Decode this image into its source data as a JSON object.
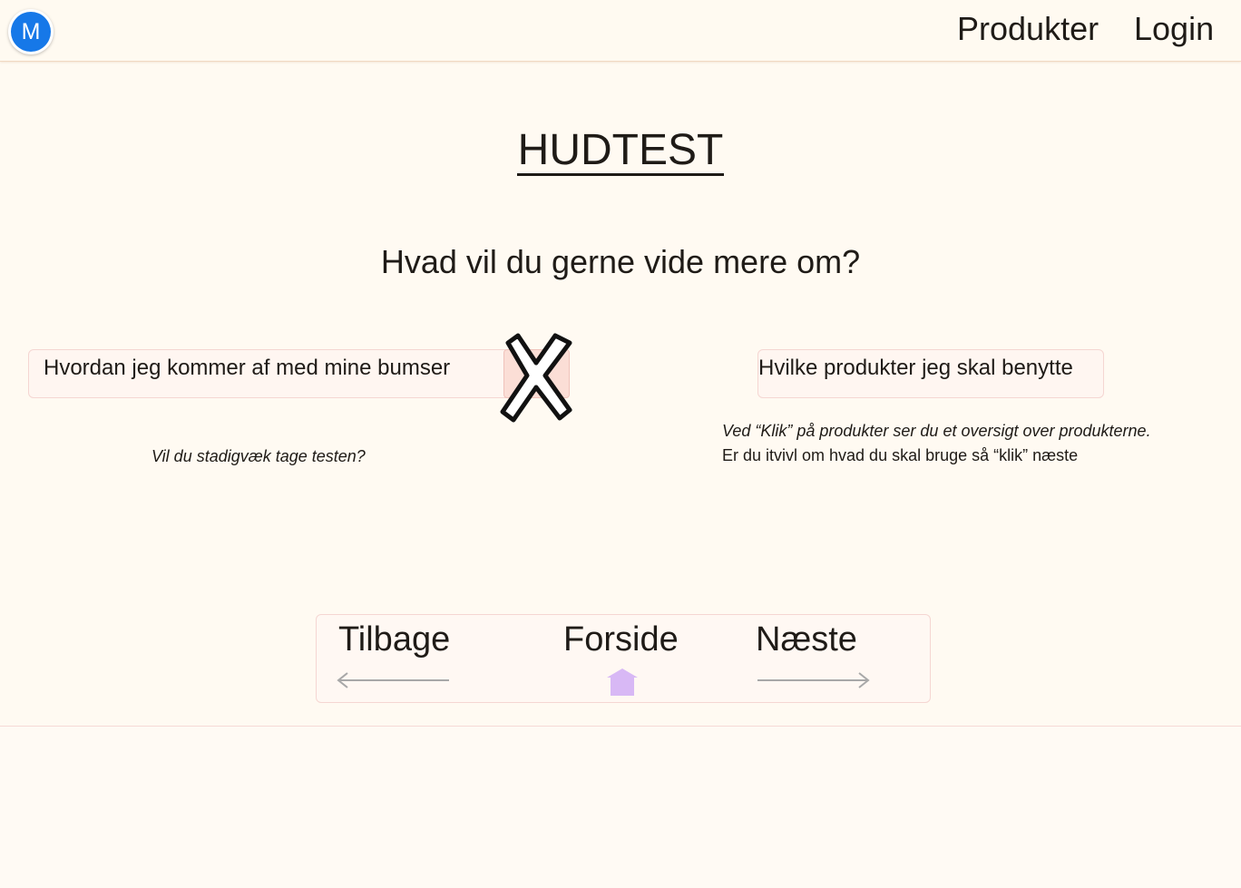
{
  "header": {
    "avatar_letter": "M",
    "nav": {
      "products": "Produkter",
      "login": "Login"
    }
  },
  "main": {
    "title": "HUDTEST",
    "question": "Hvad vil du gerne vide mere om?",
    "options": [
      {
        "label": "Hvordan jeg kommer af med mine bumser",
        "note": "Vil du stadigvæk tage testen?",
        "selected_mark": "X"
      },
      {
        "label": "Hvilke produkter jeg skal benytte",
        "note_lines": [
          "Ved “Klik” på produkter ser du et oversigt over produkterne.",
          "Er du itvivl om hvad du skal bruge så “klik” næste"
        ]
      }
    ]
  },
  "bottom_nav": {
    "back": "Tilbage",
    "home": "Forside",
    "next": "Næste"
  },
  "icons": {
    "back": "left-arrow-icon",
    "home": "home-icon",
    "next": "right-arrow-icon",
    "cross": "x-mark-icon"
  },
  "colors": {
    "background": "#fffaf2",
    "avatar": "#1678e8",
    "option_fill": "#fff6f1",
    "option_border": "#f5d6d2",
    "x_highlight": "#fbded6",
    "home_icon": "#d8b8f5",
    "arrow": "#a8a8a8"
  }
}
